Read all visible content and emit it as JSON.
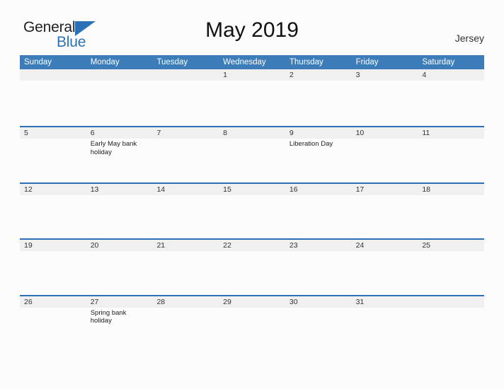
{
  "brand": {
    "name_part1": "General",
    "name_part2": "Blue",
    "triangle_icon": "triangle-icon",
    "accent_color": "#2a72b5"
  },
  "header": {
    "title": "May 2019",
    "location": "Jersey"
  },
  "calendar": {
    "header_bg": "#3c7cb8",
    "row_divider_color": "#2a72b5",
    "daynum_band_bg": "#f0f0f0",
    "weekdays": [
      "Sunday",
      "Monday",
      "Tuesday",
      "Wednesday",
      "Thursday",
      "Friday",
      "Saturday"
    ],
    "weeks": [
      [
        {
          "day": "",
          "event": ""
        },
        {
          "day": "",
          "event": ""
        },
        {
          "day": "",
          "event": ""
        },
        {
          "day": "1",
          "event": ""
        },
        {
          "day": "2",
          "event": ""
        },
        {
          "day": "3",
          "event": ""
        },
        {
          "day": "4",
          "event": ""
        }
      ],
      [
        {
          "day": "5",
          "event": ""
        },
        {
          "day": "6",
          "event": "Early May bank holiday"
        },
        {
          "day": "7",
          "event": ""
        },
        {
          "day": "8",
          "event": ""
        },
        {
          "day": "9",
          "event": "Liberation Day"
        },
        {
          "day": "10",
          "event": ""
        },
        {
          "day": "11",
          "event": ""
        }
      ],
      [
        {
          "day": "12",
          "event": ""
        },
        {
          "day": "13",
          "event": ""
        },
        {
          "day": "14",
          "event": ""
        },
        {
          "day": "15",
          "event": ""
        },
        {
          "day": "16",
          "event": ""
        },
        {
          "day": "17",
          "event": ""
        },
        {
          "day": "18",
          "event": ""
        }
      ],
      [
        {
          "day": "19",
          "event": ""
        },
        {
          "day": "20",
          "event": ""
        },
        {
          "day": "21",
          "event": ""
        },
        {
          "day": "22",
          "event": ""
        },
        {
          "day": "23",
          "event": ""
        },
        {
          "day": "24",
          "event": ""
        },
        {
          "day": "25",
          "event": ""
        }
      ],
      [
        {
          "day": "26",
          "event": ""
        },
        {
          "day": "27",
          "event": "Spring bank holiday"
        },
        {
          "day": "28",
          "event": ""
        },
        {
          "day": "29",
          "event": ""
        },
        {
          "day": "30",
          "event": ""
        },
        {
          "day": "31",
          "event": ""
        },
        {
          "day": "",
          "event": ""
        }
      ]
    ]
  }
}
